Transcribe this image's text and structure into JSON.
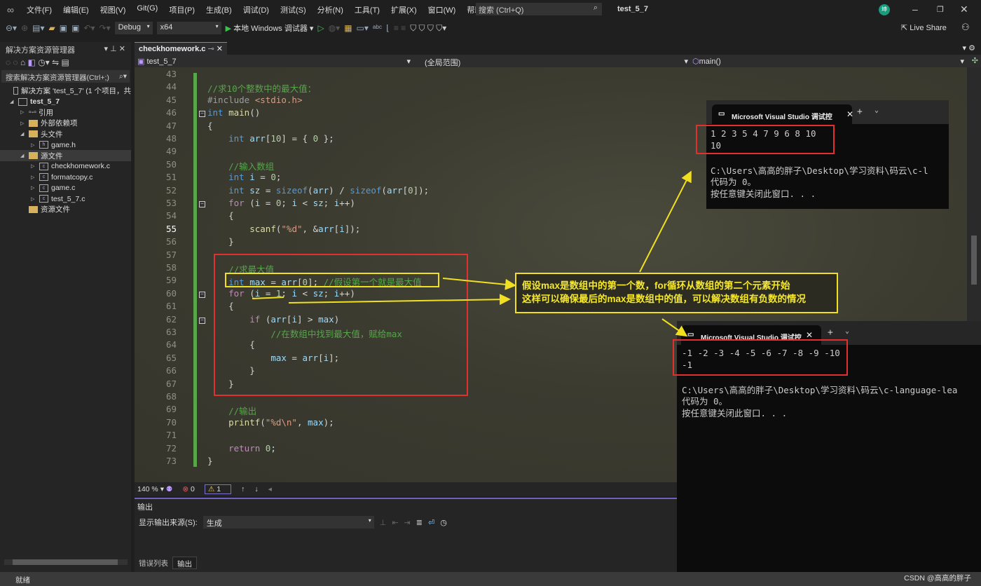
{
  "menu": [
    "文件(F)",
    "编辑(E)",
    "视图(V)",
    "Git(G)",
    "项目(P)",
    "生成(B)",
    "调试(D)",
    "测试(S)",
    "分析(N)",
    "工具(T)",
    "扩展(X)",
    "窗口(W)",
    "帮助(H)"
  ],
  "search_placeholder": "搜索 (Ctrl+Q)",
  "window_title": "test_5_7",
  "avatar_text": "坤",
  "toolbar": {
    "config": "Debug",
    "platform": "x64",
    "run_label": "本地 Windows 调试器",
    "live_share": "Live Share"
  },
  "solution_explorer": {
    "title": "解决方案资源管理器",
    "search_placeholder": "搜索解决方案资源管理器(Ctrl+;)",
    "items": [
      {
        "label": "解决方案 'test_5_7' (1 个项目，共",
        "level": 0,
        "icon": "solution-icon"
      },
      {
        "label": "test_5_7",
        "level": 0,
        "icon": "project-icon",
        "expanded": true,
        "bold": true
      },
      {
        "label": "引用",
        "level": 1,
        "icon": "references-icon",
        "expanded": false
      },
      {
        "label": "外部依赖项",
        "level": 1,
        "icon": "folder-icon",
        "expanded": false
      },
      {
        "label": "头文件",
        "level": 1,
        "icon": "folder-icon",
        "expanded": true
      },
      {
        "label": "game.h",
        "level": 2,
        "icon": "header-file-icon",
        "expanded": false
      },
      {
        "label": "源文件",
        "level": 1,
        "icon": "folder-icon",
        "expanded": true,
        "selected": true
      },
      {
        "label": "checkhomework.c",
        "level": 2,
        "icon": "c-file-icon",
        "expanded": false
      },
      {
        "label": "formatcopy.c",
        "level": 2,
        "icon": "c-file-icon",
        "expanded": false
      },
      {
        "label": "game.c",
        "level": 2,
        "icon": "c-file-icon",
        "expanded": false
      },
      {
        "label": "test_5_7.c",
        "level": 2,
        "icon": "c-file-icon",
        "expanded": false
      },
      {
        "label": "资源文件",
        "level": 1,
        "icon": "folder-icon"
      }
    ]
  },
  "editor": {
    "tab": "checkhomework.c",
    "nav_project": "test_5_7",
    "nav_scope": "(全局范围)",
    "nav_function": "main()",
    "first_line": 43,
    "current_line": 55,
    "lines": [
      "",
      "//求10个整数中的最大值：",
      "#include <stdio.h>",
      "int main()",
      "{",
      "    int arr[10] = { 0 };",
      "",
      "    //输入数组",
      "    int i = 0;",
      "    int sz = sizeof(arr) / sizeof(arr[0]);",
      "    for (i = 0; i < sz; i++)",
      "    {",
      "        scanf(\"%d\", &arr[i]);",
      "    }",
      "",
      "    //求最大值",
      "    int max = arr[0]; //假设第一个就是最大值",
      "    for (i = 1; i < sz; i++)",
      "    {",
      "        if (arr[i] > max)",
      "            //在数组中找到最大值，赋给max",
      "        {",
      "            max = arr[i];",
      "        }",
      "    }",
      "",
      "    //输出",
      "    printf(\"%d\\n\", max);",
      "",
      "    return 0;",
      "}"
    ]
  },
  "annotation": {
    "line1": "假设max是数组中的第一个数，for循环从数组的第二个元素开始",
    "line2": "这样可以确保最后的max是数组中的值，可以解决数组有负数的情况"
  },
  "status": {
    "zoom": "140 %",
    "errors": "0",
    "warnings": "1"
  },
  "output_panel": {
    "title": "输出",
    "source_label": "显示输出来源(S):",
    "source_value": "生成"
  },
  "bottom_tabs": [
    "错误列表",
    "输出"
  ],
  "statusbar": "就绪",
  "terminal1": {
    "title": "Microsoft Visual Studio 调试控",
    "lines": [
      "1 2 3 5 4 7 9 6 8 10",
      "10",
      "",
      "C:\\Users\\高高的胖子\\Desktop\\学习资料\\码云\\c-l",
      "代码为 0。",
      "按任意键关闭此窗口. . ."
    ]
  },
  "terminal2": {
    "title": "Microsoft Visual Studio 调试控",
    "lines": [
      "-1 -2 -3 -4 -5 -6 -7 -8 -9 -10",
      "-1",
      "",
      "C:\\Users\\高高的胖子\\Desktop\\学习资料\\码云\\c-language-lea",
      "代码为 0。",
      "按任意键关闭此窗口. . ."
    ]
  },
  "watermark": "CSDN @高高的胖子",
  "colors": {
    "accent": "#7060c0",
    "annotation_red": "#e03030",
    "annotation_yellow": "#f0e020",
    "change_bar": "#57a64a"
  }
}
